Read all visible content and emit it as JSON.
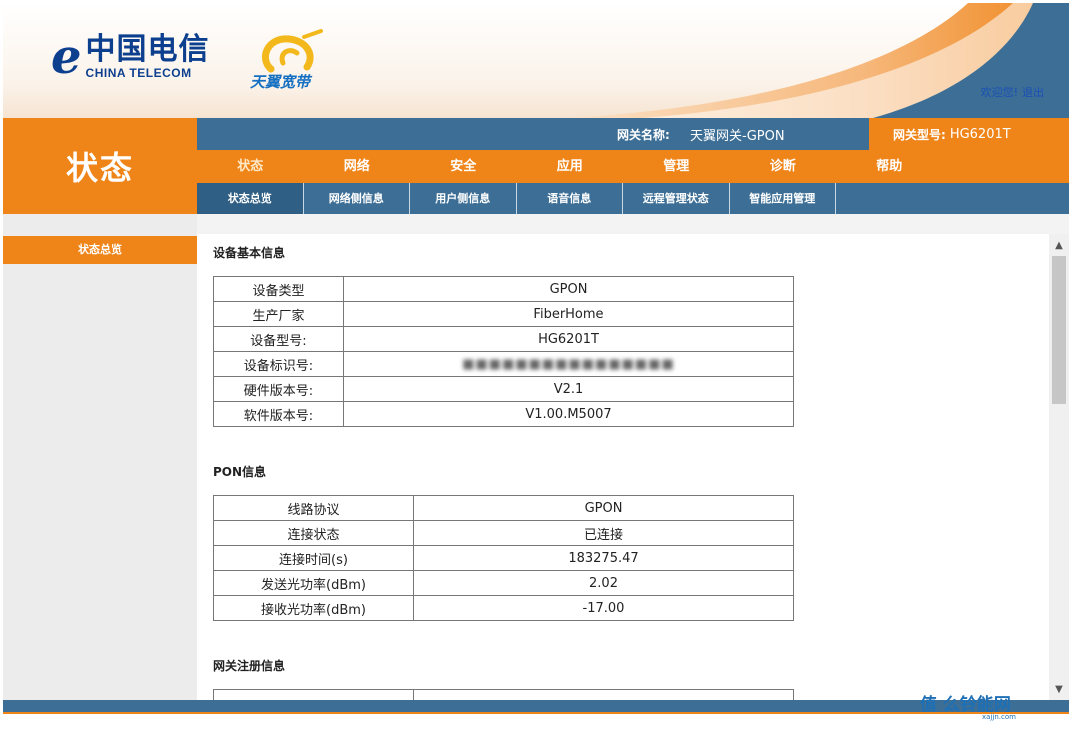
{
  "header": {
    "brand_cn": "中国电信",
    "brand_en": "CHINA TELECOM",
    "tianyi": "天翼宽带",
    "welcome": "欢迎您!",
    "logout": "退出"
  },
  "page_title": "状态",
  "infobar": {
    "gw_name_label": "网关名称:",
    "gw_name_value": "天翼网关-GPON",
    "gw_model_label": "网关型号:",
    "gw_model_value": "HG6201T"
  },
  "mainnav": [
    "状态",
    "网络",
    "安全",
    "应用",
    "管理",
    "诊断",
    "帮助"
  ],
  "subnav": [
    "状态总览",
    "网络侧信息",
    "用户侧信息",
    "语音信息",
    "远程管理状态",
    "智能应用管理"
  ],
  "sidebar": {
    "item": "状态总览"
  },
  "device": {
    "title": "设备基本信息",
    "rows": [
      {
        "label": "设备类型",
        "value": "GPON"
      },
      {
        "label": "生产厂家",
        "value": "FiberHome"
      },
      {
        "label": "设备型号:",
        "value": "HG6201T"
      },
      {
        "label": "设备标识号:",
        "value": ""
      },
      {
        "label": "硬件版本号:",
        "value": "V2.1"
      },
      {
        "label": "软件版本号:",
        "value": "V1.00.M5007"
      }
    ]
  },
  "pon": {
    "title": "PON信息",
    "rows": [
      {
        "label": "线路协议",
        "value": "GPON"
      },
      {
        "label": "连接状态",
        "value": "已连接"
      },
      {
        "label": "连接时间(s)",
        "value": "183275.47"
      },
      {
        "label": "发送光功率(dBm)",
        "value": "2.02"
      },
      {
        "label": "接收光功率(dBm)",
        "value": "-17.00"
      }
    ]
  },
  "gw_reg": {
    "title": "网关注册信息"
  },
  "watermark": {
    "main": "值 么铃能网",
    "small": "xajjn.com"
  },
  "colors": {
    "orange": "#ef8519",
    "blue": "#3d6f96",
    "brand_blue": "#0d3f8f"
  }
}
